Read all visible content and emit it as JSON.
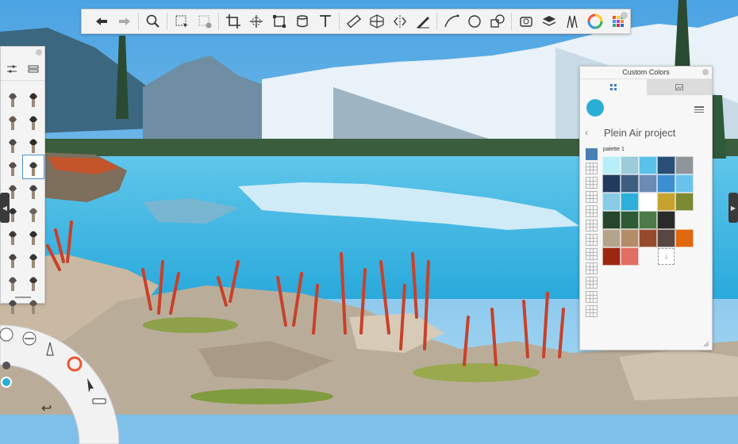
{
  "toolbar": {
    "tools": [
      {
        "name": "undo-icon"
      },
      {
        "name": "redo-icon"
      },
      {
        "name": "zoom-icon"
      },
      {
        "name": "select-icon"
      },
      {
        "name": "clear-selection-icon"
      },
      {
        "name": "crop-icon"
      },
      {
        "name": "transform-icon"
      },
      {
        "name": "distort-icon"
      },
      {
        "name": "layer-fill-icon"
      },
      {
        "name": "text-icon"
      },
      {
        "name": "ruler-icon"
      },
      {
        "name": "perspective-icon"
      },
      {
        "name": "symmetry-icon"
      },
      {
        "name": "stroke-tool-icon"
      },
      {
        "name": "curve-icon"
      },
      {
        "name": "ellipse-icon"
      },
      {
        "name": "shape-icon"
      },
      {
        "name": "reference-icon"
      },
      {
        "name": "layers-icon"
      },
      {
        "name": "brush-library-icon"
      },
      {
        "name": "color-wheel-icon"
      },
      {
        "name": "copic-colors-icon"
      }
    ]
  },
  "colors_panel": {
    "title": "Custom Colors",
    "current_color": "#2aaed6",
    "set_name": "Plein Air project",
    "back_glyph": "‹",
    "palette_label": "palette 1",
    "palette_count": 12,
    "swatches": [
      "#b7eef7",
      "#9ccbd9",
      "#5ac2e9",
      "#2a4e75",
      "#8e959b",
      "#223a5e",
      "#3c5e80",
      "#6b8bb3",
      "#3d8fd1",
      "#6ac2ec",
      "#88cbe6",
      "#2eaedb",
      "#ffffff",
      "#c8a22e",
      "#7c8a31",
      "#27452b",
      "#2c5b35",
      "#4d7a48",
      "#2a2a2a",
      "",
      "#b4a48d",
      "#b48c6a",
      "#954a2e",
      "#574642",
      "#e0680e",
      "#9b2710",
      "#e06e64",
      "",
      "add",
      ""
    ]
  },
  "left_handle_glyph": "◀",
  "right_handle_glyph": "▶",
  "puck_back_glyph": "↩"
}
